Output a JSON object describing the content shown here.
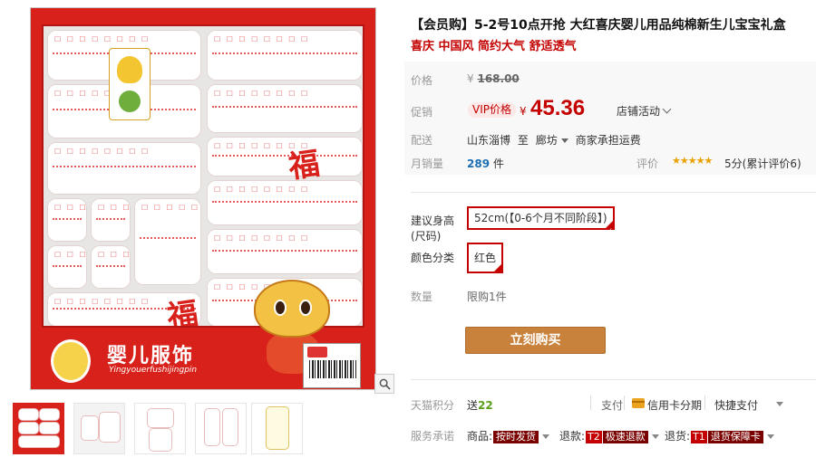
{
  "product": {
    "title": "【会员购】5-2号10点开抢 大红喜庆婴儿用品纯棉新生儿宝宝礼盒",
    "subtitle": "喜庆 中国风 简约大气 舒适透气"
  },
  "gallery": {
    "brand_name": "婴儿服饰",
    "brand_sub": "Yingyouerfushijingpin",
    "fu_char": "福"
  },
  "price": {
    "label": "价格",
    "currency": "¥",
    "original": "168.00",
    "promo_label": "促销",
    "vip_badge": "VIP价格",
    "promo_currency": "¥",
    "promo_value": "45.36",
    "store_promo": "店铺活动"
  },
  "shipping": {
    "label": "配送",
    "from": "山东淄博",
    "to_word": "至",
    "to": "廊坊",
    "fee": "商家承担运费"
  },
  "sales": {
    "label": "月销量",
    "count": "289",
    "unit": "件",
    "rating_label": "评价",
    "stars": "★★★★★",
    "rating_text": "5分(累计评价6)"
  },
  "options": {
    "height_label": "建议身高(尺码)",
    "height_value": "52cm(【0-6个月不同阶段】)",
    "color_label": "颜色分类",
    "color_value": "红色",
    "qty_label": "数量",
    "qty_text": "限购1件"
  },
  "actions": {
    "buy_now": "立刻购买"
  },
  "points": {
    "label": "天猫积分",
    "prefix": "送",
    "value": "22"
  },
  "payment": {
    "label": "支付",
    "card": "信用卡分期",
    "quick": "快捷支付"
  },
  "service": {
    "label": "服务承诺",
    "items": [
      {
        "prefix": "商品:",
        "badge": "按时发货"
      },
      {
        "prefix": "退款:",
        "tag": "T2",
        "badge": "极速退款"
      },
      {
        "prefix": "退货:",
        "tag": "T1",
        "badge": "退货保障卡"
      }
    ]
  },
  "colors": {
    "accent": "#c40000",
    "buy_button": "#c9823c",
    "box_red": "#d8211a"
  }
}
